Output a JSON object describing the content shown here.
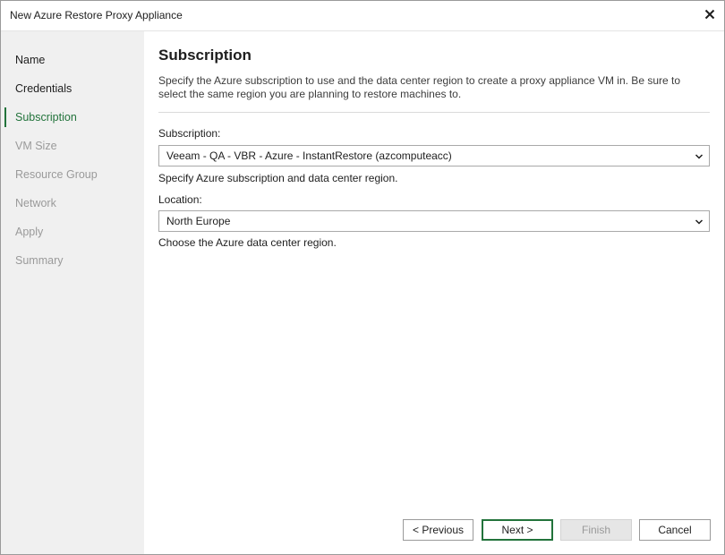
{
  "window": {
    "title": "New Azure Restore Proxy Appliance",
    "close_icon": "close-icon"
  },
  "sidebar": {
    "items": [
      {
        "label": "Name",
        "state": "done"
      },
      {
        "label": "Credentials",
        "state": "done"
      },
      {
        "label": "Subscription",
        "state": "active"
      },
      {
        "label": "VM Size",
        "state": "disabled"
      },
      {
        "label": "Resource Group",
        "state": "disabled"
      },
      {
        "label": "Network",
        "state": "disabled"
      },
      {
        "label": "Apply",
        "state": "disabled"
      },
      {
        "label": "Summary",
        "state": "disabled"
      }
    ]
  },
  "main": {
    "heading": "Subscription",
    "description": "Specify the Azure subscription to use and the data center region to create a proxy appliance VM in. Be sure to select the same region you are planning to restore machines to.",
    "subscription": {
      "label": "Subscription:",
      "value": "Veeam - QA - VBR - Azure - InstantRestore (azcomputeacc)",
      "hint": "Specify Azure subscription and data center region."
    },
    "location": {
      "label": "Location:",
      "value": "North Europe",
      "hint": "Choose the Azure data center region."
    }
  },
  "buttons": {
    "previous": "< Previous",
    "next": "Next >",
    "finish": "Finish",
    "cancel": "Cancel"
  },
  "colors": {
    "accent": "#22733b",
    "sidebar_bg": "#f0f0f0",
    "disabled_text": "#9a9a9a"
  }
}
